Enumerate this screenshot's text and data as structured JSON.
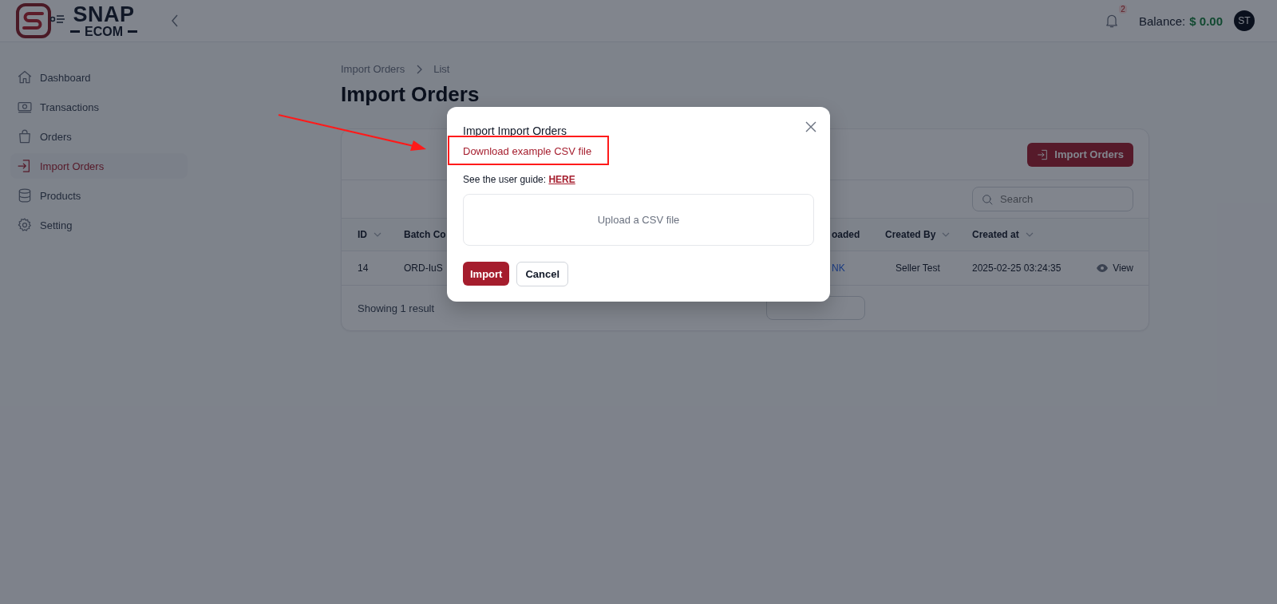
{
  "header": {
    "logo_line1": "SNAP",
    "logo_line2": "ECOM",
    "notification_count": "2",
    "balance_label": "Balance:",
    "balance_value": "$ 0.00",
    "avatar": "ST"
  },
  "sidebar": {
    "items": [
      {
        "label": "Dashboard",
        "selected": false
      },
      {
        "label": "Transactions",
        "selected": false
      },
      {
        "label": "Orders",
        "selected": false
      },
      {
        "label": "Import Orders",
        "selected": true
      },
      {
        "label": "Products",
        "selected": false
      },
      {
        "label": "Setting",
        "selected": false
      }
    ]
  },
  "breadcrumb": [
    "Import Orders",
    "List"
  ],
  "page_title": "Import Orders",
  "card": {
    "action_button": "Import Orders",
    "search": {
      "placeholder": "Search"
    },
    "table": {
      "columns": [
        {
          "label": "ID",
          "sortable": true
        },
        {
          "label": "Batch Co"
        },
        {
          "label": "oaded"
        },
        {
          "label": "Created By",
          "sortable": true
        },
        {
          "label": "Created at",
          "sortable": true
        }
      ],
      "rows": [
        [
          {
            "text": "14",
            "kind": "text"
          },
          {
            "text": "ORD-IuS",
            "kind": "text"
          },
          {
            "text": "NK",
            "kind": "link"
          },
          {
            "text": "Seller Test",
            "kind": "text"
          },
          {
            "text": "2025-02-25 03:24:35",
            "kind": "text"
          },
          {
            "text": "View",
            "kind": "action"
          }
        ]
      ]
    },
    "footer": "Showing 1 result"
  },
  "modal": {
    "title": "Import Import Orders",
    "download_link": "Download example CSV file",
    "guide_text": "See the user guide:",
    "guide_link": "HERE",
    "upload_label": "Upload a CSV file",
    "buttons": [
      {
        "label": "Import",
        "kind": "primary"
      },
      {
        "label": "Cancel",
        "kind": "secondary"
      }
    ]
  }
}
